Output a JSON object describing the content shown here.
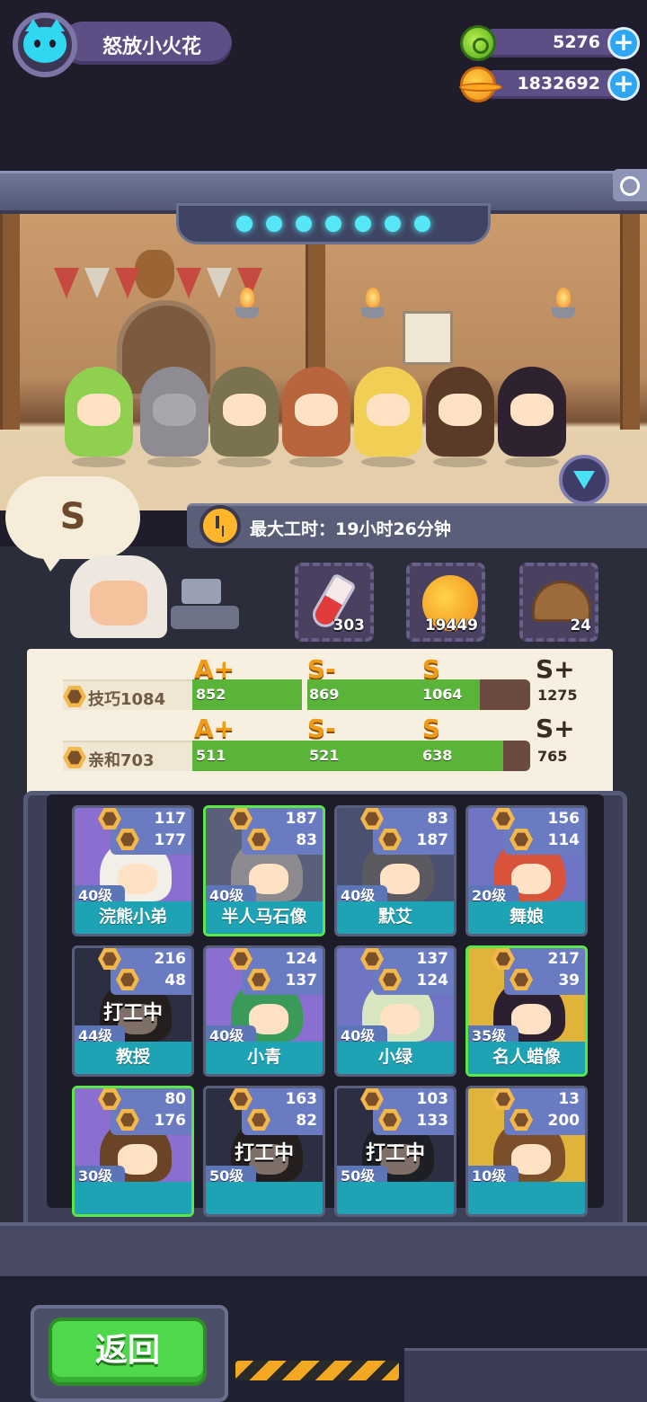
{
  "player": {
    "name": "怒放小火花",
    "avatar_icon": "cat-face-icon"
  },
  "currencies": [
    {
      "icon": "green-gem-icon",
      "value": "5276"
    },
    {
      "icon": "gold-planet-coin-icon",
      "value": "1832692"
    }
  ],
  "speech_bubble": {
    "grade": "S"
  },
  "work_time": {
    "label": "最大工时：19小时26分钟"
  },
  "items": [
    {
      "icon": "red-potion-icon",
      "count": "303"
    },
    {
      "icon": "gold-planet-orb-icon",
      "count": "19449"
    },
    {
      "icon": "leather-helmet-icon",
      "count": "24"
    }
  ],
  "stats": [
    {
      "label": "技巧1084",
      "grades": [
        "A+",
        "S-",
        "S",
        "S+"
      ],
      "thresholds": [
        "852",
        "869",
        "1064",
        "1275"
      ],
      "fill_fraction": 0.85
    },
    {
      "label": "亲和703",
      "grades": [
        "A+",
        "S-",
        "S",
        "S+"
      ],
      "thresholds": [
        "511",
        "521",
        "638",
        "765"
      ],
      "fill_fraction": 0.92
    }
  ],
  "characters": [
    {
      "name": "浣熊小弟",
      "level": "40级",
      "stat1": "117",
      "stat2": "177",
      "status": "",
      "selected": false
    },
    {
      "name": "半人马石像",
      "level": "40级",
      "stat1": "187",
      "stat2": "83",
      "status": "",
      "selected": true
    },
    {
      "name": "默艾",
      "level": "40级",
      "stat1": "83",
      "stat2": "187",
      "status": "",
      "selected": false
    },
    {
      "name": "舞娘",
      "level": "20级",
      "stat1": "156",
      "stat2": "114",
      "status": "",
      "selected": false
    },
    {
      "name": "教授",
      "level": "44级",
      "stat1": "216",
      "stat2": "48",
      "status": "打工中",
      "selected": false
    },
    {
      "name": "小青",
      "level": "40级",
      "stat1": "124",
      "stat2": "137",
      "status": "",
      "selected": false
    },
    {
      "name": "小绿",
      "level": "40级",
      "stat1": "137",
      "stat2": "124",
      "status": "",
      "selected": false
    },
    {
      "name": "名人蜡像",
      "level": "35级",
      "stat1": "217",
      "stat2": "39",
      "status": "",
      "selected": true
    },
    {
      "name": "",
      "level": "30级",
      "stat1": "80",
      "stat2": "176",
      "status": "",
      "selected": true
    },
    {
      "name": "",
      "level": "50级",
      "stat1": "163",
      "stat2": "82",
      "status": "打工中",
      "selected": false
    },
    {
      "name": "",
      "level": "50级",
      "stat1": "103",
      "stat2": "133",
      "status": "打工中",
      "selected": false
    },
    {
      "name": "",
      "level": "10级",
      "stat1": "13",
      "stat2": "200",
      "status": "",
      "selected": false
    }
  ],
  "back_button": {
    "label": "返回"
  }
}
